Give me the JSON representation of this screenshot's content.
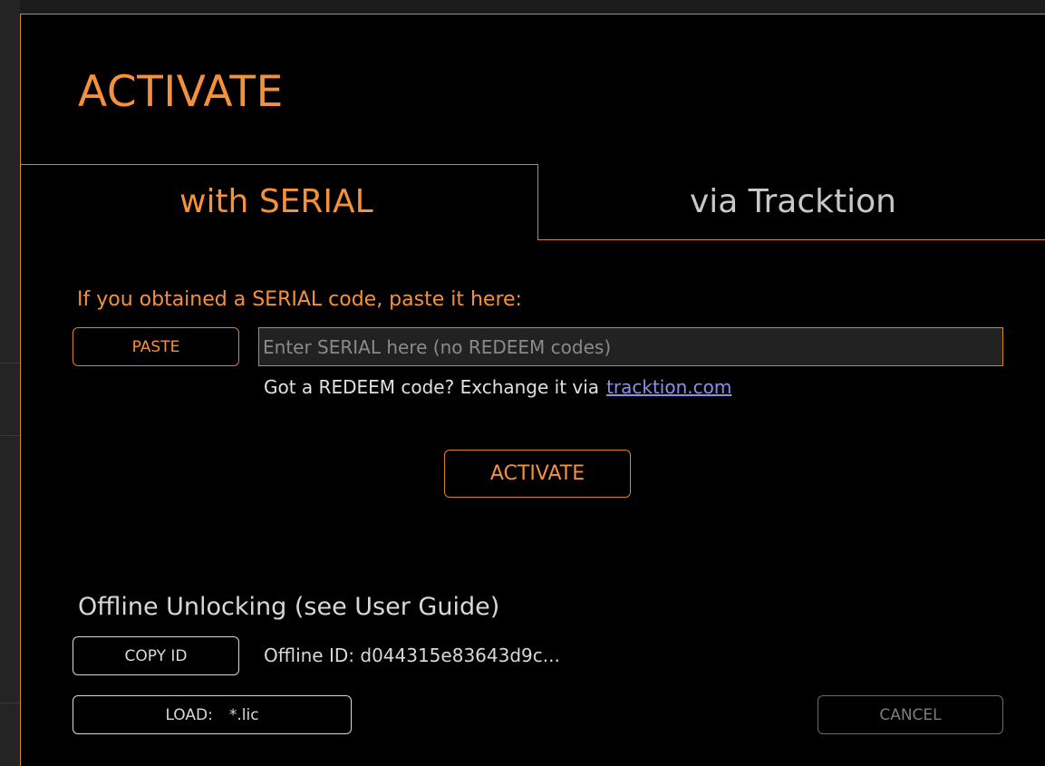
{
  "dialog": {
    "title": "ACTIVATE",
    "tabs": [
      {
        "label": "with SERIAL",
        "active": true
      },
      {
        "label": "via Tracktion",
        "active": false
      }
    ]
  },
  "serial": {
    "prompt": "If you obtained a SERIAL code, paste it here:",
    "paste_label": "PASTE",
    "input_value": "",
    "input_placeholder": "Enter SERIAL here (no REDEEM codes)",
    "redeem_text": "Got a REDEEM code? Exchange it via",
    "redeem_link": "tracktion.com",
    "activate_label": "ACTIVATE"
  },
  "offline": {
    "title": "Offline Unlocking (see User Guide)",
    "copy_id_label": "COPY ID",
    "offline_id_text": "Offline ID: d044315e83643d9c...",
    "load_label": "LOAD:",
    "load_ext": "*.lic",
    "cancel_label": "CANCEL"
  },
  "colors": {
    "accent": "#f5913a",
    "border_accent": "#d9822b",
    "background": "#000000",
    "text_light": "#d8d8d8",
    "link": "#8e8ef0",
    "disabled": "#7d7d7d"
  }
}
